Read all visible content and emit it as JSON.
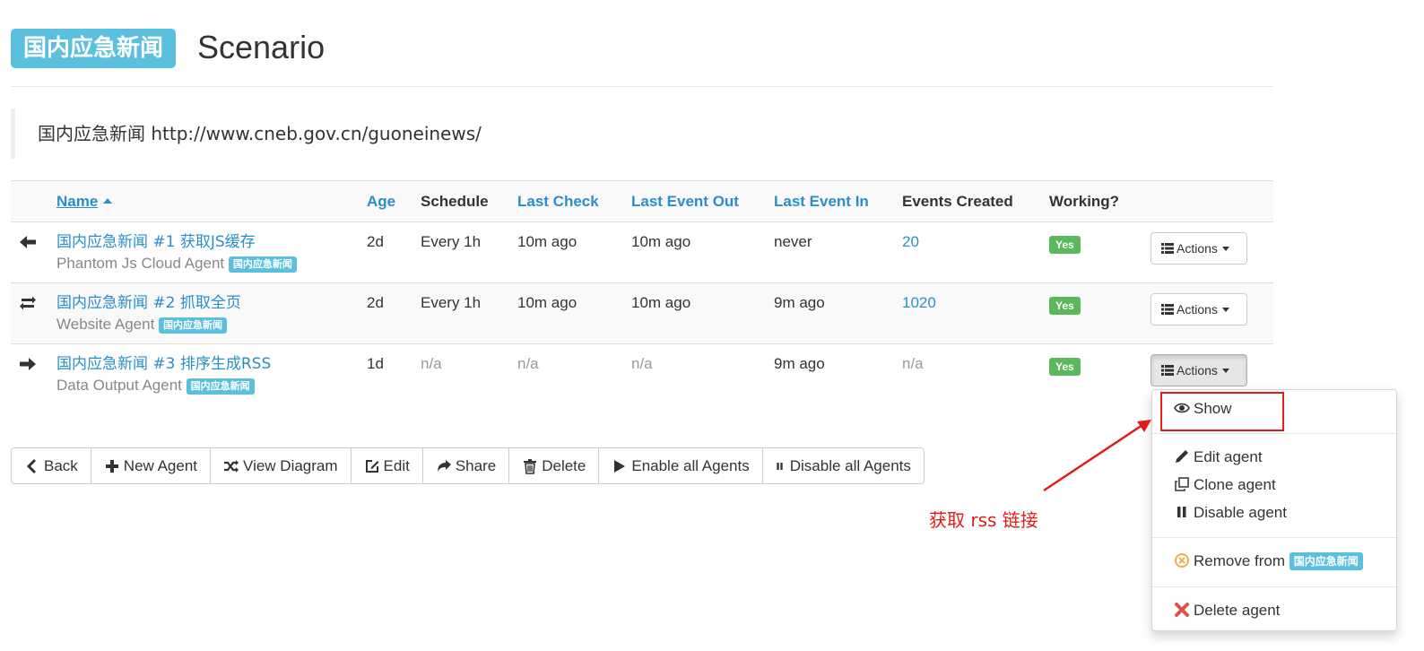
{
  "header": {
    "scenario_badge": "国内应急新闻",
    "title": "Scenario"
  },
  "description": "国内应急新闻 http://www.cneb.gov.cn/guoneinews/",
  "table": {
    "columns": {
      "name": "Name",
      "age": "Age",
      "schedule": "Schedule",
      "last_check": "Last Check",
      "last_event_out": "Last Event Out",
      "last_event_in": "Last Event In",
      "events_created": "Events Created",
      "working": "Working?"
    },
    "rows": [
      {
        "direction_icon": "arrow-left-icon",
        "name": "国内应急新闻 #1 获取JS缓存",
        "type": "Phantom Js Cloud Agent",
        "scenario_tag": "国内应急新闻",
        "age": "2d",
        "schedule": "Every 1h",
        "last_check": "10m ago",
        "last_event_out": "10m ago",
        "last_event_in": "never",
        "events_created": "20",
        "working": "Yes",
        "actions_label": "Actions"
      },
      {
        "direction_icon": "arrows-exchange-icon",
        "name": "国内应急新闻 #2 抓取全页",
        "type": "Website Agent",
        "scenario_tag": "国内应急新闻",
        "age": "2d",
        "schedule": "Every 1h",
        "last_check": "10m ago",
        "last_event_out": "10m ago",
        "last_event_in": "9m ago",
        "events_created": "1020",
        "working": "Yes",
        "actions_label": "Actions"
      },
      {
        "direction_icon": "arrow-right-icon",
        "name": "国内应急新闻 #3 排序生成RSS",
        "type": "Data Output Agent",
        "scenario_tag": "国内应急新闻",
        "age": "1d",
        "schedule": "n/a",
        "last_check": "n/a",
        "last_event_out": "n/a",
        "last_event_in": "9m ago",
        "events_created": "n/a",
        "working": "Yes",
        "actions_label": "Actions"
      }
    ]
  },
  "toolbar": {
    "back": "Back",
    "new_agent": "New Agent",
    "view_diagram": "View Diagram",
    "edit": "Edit",
    "share": "Share",
    "delete": "Delete",
    "enable_all": "Enable all Agents",
    "disable_all": "Disable all Agents"
  },
  "dropdown": {
    "show": "Show",
    "edit_agent": "Edit agent",
    "clone_agent": "Clone agent",
    "disable_agent": "Disable agent",
    "remove_from": "Remove from",
    "remove_scenario_tag": "国内应急新闻",
    "delete_agent": "Delete agent"
  },
  "annotation": {
    "text": "获取 rss 链接"
  },
  "colors": {
    "link": "#2a8fc9",
    "badge_info": "#5bc0de",
    "badge_success": "#5cb85c",
    "annotation_red": "#e31b1b",
    "remove_orange": "#f0ad4e",
    "delete_red": "#d9534f"
  }
}
